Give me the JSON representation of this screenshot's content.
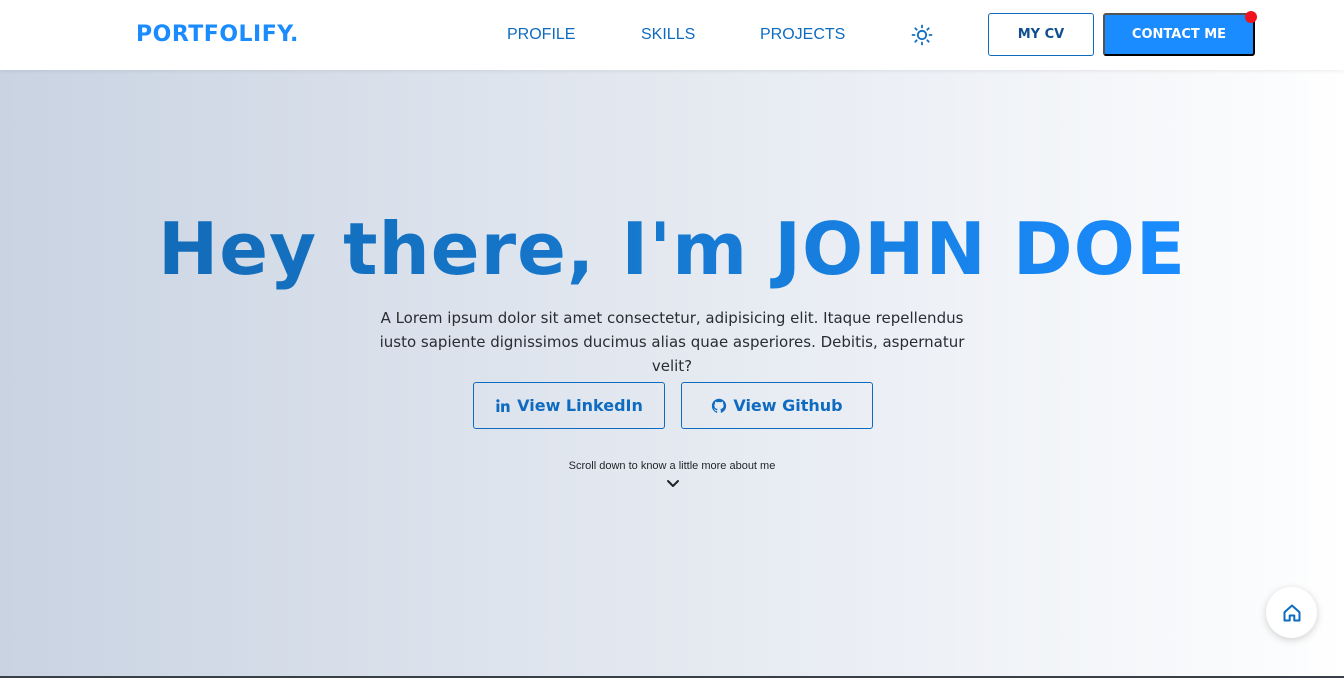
{
  "brand": {
    "logo_text": "PORTFOLIFY."
  },
  "nav": {
    "links": [
      {
        "label": "PROFILE"
      },
      {
        "label": "SKILLS"
      },
      {
        "label": "PROJECTS"
      }
    ],
    "theme_icon": "sun-icon",
    "cv_button": "MY CV",
    "contact_button": "CONTACT ME",
    "contact_has_notification": true
  },
  "hero": {
    "title": "Hey there, I'm JOHN DOE",
    "description": "A Lorem ipsum dolor sit amet consectetur, adipisicing elit. Itaque repellendus iusto sapiente dignissimos ducimus alias quae asperiores. Debitis, aspernatur velit?",
    "buttons": [
      {
        "label": "View LinkedIn",
        "icon": "linkedin-icon"
      },
      {
        "label": "View Github",
        "icon": "github-icon"
      }
    ],
    "scroll_hint": "Scroll down to know a little more about me",
    "scroll_icon": "chevron-down-icon"
  },
  "floating": {
    "home_icon": "home-icon"
  },
  "colors": {
    "primary": "#1a8cff",
    "primary_dark": "#0f6bbf",
    "notification": "#f0131e",
    "text": "#2a2d33"
  }
}
